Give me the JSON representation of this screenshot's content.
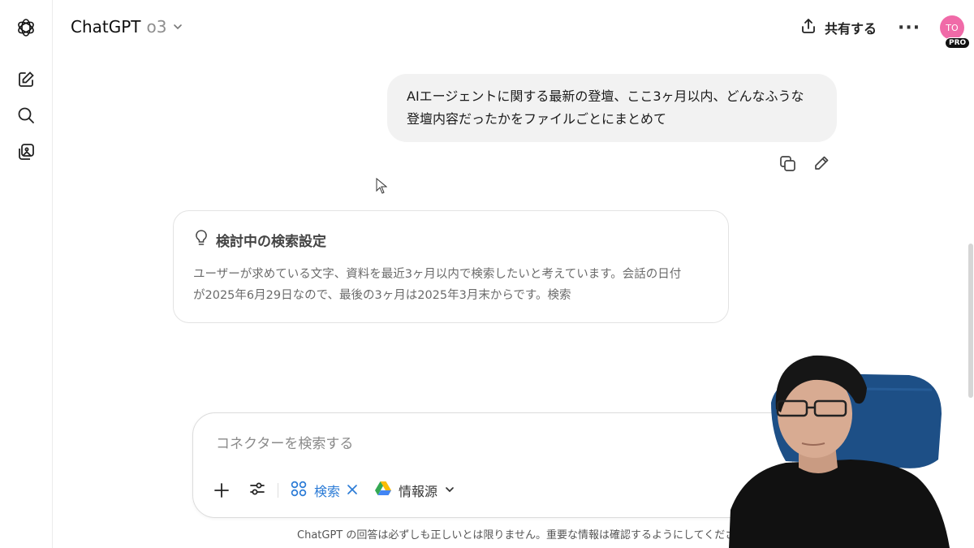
{
  "header": {
    "model_name": "ChatGPT",
    "model_version": "o3",
    "share_label": "共有する",
    "avatar_initials": "TO",
    "plan_badge": "PRO"
  },
  "sidebar": {
    "items": [
      {
        "icon": "openai-logo-icon"
      },
      {
        "icon": "new-chat-icon"
      },
      {
        "icon": "search-icon"
      },
      {
        "icon": "library-icon"
      }
    ]
  },
  "conversation": {
    "user_message_line1": "AIエージェントに関する最新の登壇、ここ3ヶ月以内、どんなふうな",
    "user_message_line2": "登壇内容だったかをファイルごとにまとめて",
    "reasoning_title": "検討中の検索設定",
    "reasoning_line1": "ユーザーが求めている文字、資料を最近3ヶ月以内で検索したいと考えています。会話の日付",
    "reasoning_line2": "が2025年6月29日なので、最後の3ヶ月は2025年3月末からです。検索"
  },
  "composer": {
    "placeholder": "コネクターを検索する",
    "search_label": "検索",
    "source_label": "情報源"
  },
  "footer": {
    "disclaimer": "ChatGPT の回答は必ずしも正しいとは限りません。重要な情報は確認するようにしてください。"
  },
  "colors": {
    "accent_blue": "#2b7bd6",
    "avatar_pink": "#f06aa8"
  }
}
